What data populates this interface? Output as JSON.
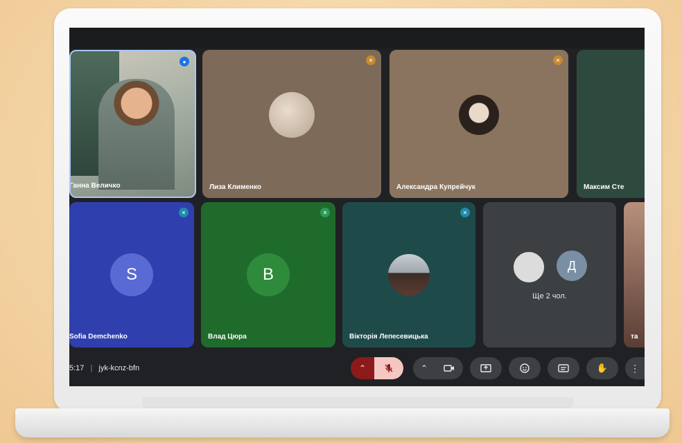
{
  "meeting": {
    "time": "5:17",
    "separator": "|",
    "code": "jyk-kcnz-bfn"
  },
  "participants": [
    {
      "name": "Ганна Величко"
    },
    {
      "name": "Лиза Клименко"
    },
    {
      "name": "Александра Купрейчук"
    },
    {
      "name": "Максим Сте"
    },
    {
      "name": "Sofia Demchenko",
      "initial": "S"
    },
    {
      "name": "Влад Цюра",
      "initial": "B"
    },
    {
      "name": "Вікторія Лепесевицька"
    },
    {
      "name": "та"
    }
  ],
  "others": {
    "label": "Ще 2 чол.",
    "initial": "Д"
  },
  "controls": [
    "chevron-up",
    "mic-off",
    "chevron-up",
    "camera",
    "present",
    "emoji",
    "captions",
    "raise-hand",
    "more"
  ],
  "colors": {
    "accent_red": "#8b1a1a",
    "mic_off": "#f4c7c3",
    "tile_blue": "#2f3fae",
    "tile_green": "#1f6b2c"
  }
}
